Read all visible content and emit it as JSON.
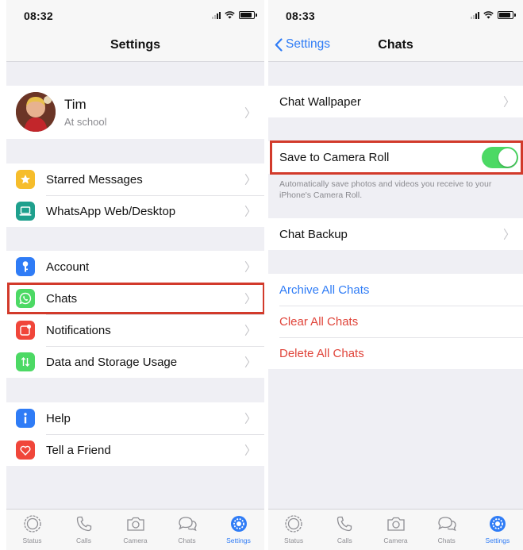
{
  "left": {
    "status": {
      "time": "08:32"
    },
    "title": "Settings",
    "profile": {
      "name": "Tim",
      "status": "At school"
    },
    "groups": [
      [
        {
          "key": "starred",
          "label": "Starred Messages",
          "icon": "star-icon",
          "color": "#f6bd2b"
        },
        {
          "key": "web",
          "label": "WhatsApp Web/Desktop",
          "icon": "laptop-icon",
          "color": "#1fa08d"
        }
      ],
      [
        {
          "key": "account",
          "label": "Account",
          "icon": "key-icon",
          "color": "#2f7cf6"
        },
        {
          "key": "chats",
          "label": "Chats",
          "icon": "whatsapp-icon",
          "color": "#4cd964"
        },
        {
          "key": "notifications",
          "label": "Notifications",
          "icon": "notification-icon",
          "color": "#f0463a"
        },
        {
          "key": "data",
          "label": "Data and Storage Usage",
          "icon": "arrows-icon",
          "color": "#4cd964"
        }
      ],
      [
        {
          "key": "help",
          "label": "Help",
          "icon": "info-icon",
          "color": "#2f7cf6"
        },
        {
          "key": "friend",
          "label": "Tell a Friend",
          "icon": "heart-icon",
          "color": "#f0463a"
        }
      ]
    ]
  },
  "right": {
    "status": {
      "time": "08:33"
    },
    "back_label": "Settings",
    "title": "Chats",
    "wallpaper_label": "Chat Wallpaper",
    "save_label": "Save to Camera Roll",
    "save_enabled": true,
    "save_note": "Automatically save photos and videos you receive to your iPhone's Camera Roll.",
    "backup_label": "Chat Backup",
    "archive_label": "Archive All Chats",
    "clear_label": "Clear All Chats",
    "delete_label": "Delete All Chats"
  },
  "tabs": [
    {
      "label": "Status",
      "icon": "status-icon"
    },
    {
      "label": "Calls",
      "icon": "phone-icon"
    },
    {
      "label": "Camera",
      "icon": "camera-icon"
    },
    {
      "label": "Chats",
      "icon": "chat-bubbles-icon"
    },
    {
      "label": "Settings",
      "icon": "gear-icon",
      "active": true
    }
  ],
  "colors": {
    "accent": "#2f7cf6",
    "destructive": "#e0443a",
    "toggle_on": "#4cd964",
    "highlight": "#d23a2b"
  }
}
